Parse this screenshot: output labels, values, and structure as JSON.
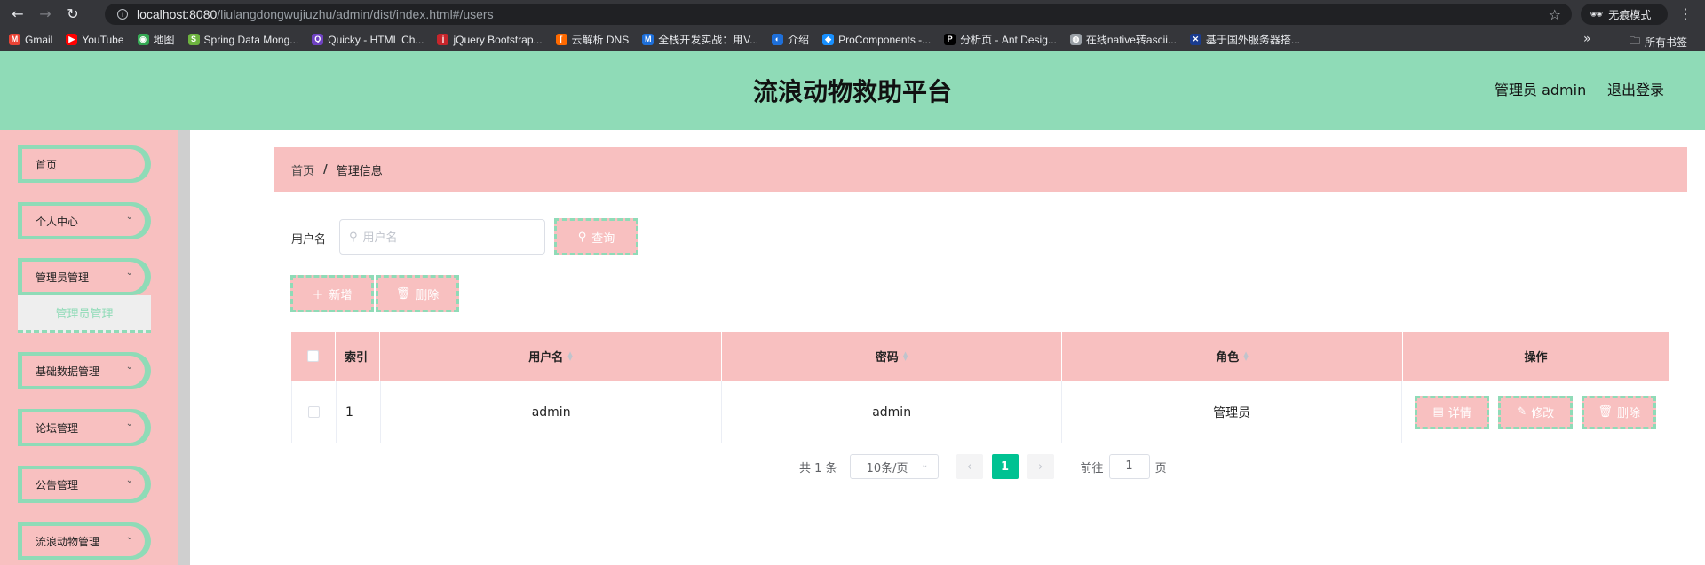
{
  "browser": {
    "url_host": "localhost:8080",
    "url_path": "/liulangdongwujiuzhu/admin/dist/index.html#/users",
    "incognito_label": "无痕模式",
    "bookmarks": [
      {
        "label": "Gmail",
        "color": "#ea4335",
        "glyph": "M"
      },
      {
        "label": "YouTube",
        "color": "#ff0000",
        "glyph": "▶"
      },
      {
        "label": "地图",
        "color": "#34a853",
        "glyph": "◉"
      },
      {
        "label": "Spring Data Mong...",
        "color": "#6db33f",
        "glyph": "S"
      },
      {
        "label": "Quicky - HTML Ch...",
        "color": "#6f42c1",
        "glyph": "Q"
      },
      {
        "label": "jQuery Bootstrap...",
        "color": "#c7252b",
        "glyph": "j"
      },
      {
        "label": "云解析 DNS",
        "color": "#ff6a00",
        "glyph": "["
      },
      {
        "label": "全栈开发实战：用V...",
        "color": "#1e6fd9",
        "glyph": "M"
      },
      {
        "label": "介绍",
        "color": "#1e6fd9",
        "glyph": "◐"
      },
      {
        "label": "ProComponents -...",
        "color": "#1890ff",
        "glyph": "◆"
      },
      {
        "label": "分析页 - Ant Desig...",
        "color": "#000000",
        "glyph": "P"
      },
      {
        "label": "在线native转ascii...",
        "color": "#9aa0a6",
        "glyph": "◍"
      },
      {
        "label": "基于国外服务器搭...",
        "color": "#1a3c8f",
        "glyph": "✕"
      }
    ],
    "bookmarks_more": "»",
    "all_bookmarks": "所有书签"
  },
  "header": {
    "title": "流浪动物救助平台",
    "admin_label": "管理员 admin",
    "logout_label": "退出登录"
  },
  "sidebar": {
    "items": [
      {
        "label": "首页",
        "has_chevron": false
      },
      {
        "label": "个人中心",
        "has_chevron": true
      },
      {
        "label": "管理员管理",
        "has_chevron": true
      },
      {
        "label": "基础数据管理",
        "has_chevron": true
      },
      {
        "label": "论坛管理",
        "has_chevron": true
      },
      {
        "label": "公告管理",
        "has_chevron": true
      },
      {
        "label": "流浪动物管理",
        "has_chevron": true
      }
    ],
    "submenu_active": "管理员管理"
  },
  "breadcrumb": {
    "home": "首页",
    "separator": "/",
    "current": "管理信息"
  },
  "search": {
    "label": "用户名",
    "placeholder": "用户名",
    "query_button": "查询"
  },
  "actions": {
    "add_button": "新增",
    "delete_button": "删除"
  },
  "table": {
    "headers": {
      "index": "索引",
      "username": "用户名",
      "password": "密码",
      "role": "角色",
      "operations": "操作"
    },
    "rows": [
      {
        "index": "1",
        "username": "admin",
        "password": "admin",
        "role": "管理员"
      }
    ],
    "row_buttons": {
      "detail": "详情",
      "edit": "修改",
      "delete": "删除"
    }
  },
  "pagination": {
    "total": "共 1 条",
    "page_size": "10条/页",
    "current_page": "1",
    "goto_label": "前往",
    "goto_value": "1",
    "page_suffix": "页"
  },
  "colors": {
    "header_green": "#8fdbb7",
    "sidebar_pink": "#f8c0c0",
    "active_page": "#00c292"
  }
}
